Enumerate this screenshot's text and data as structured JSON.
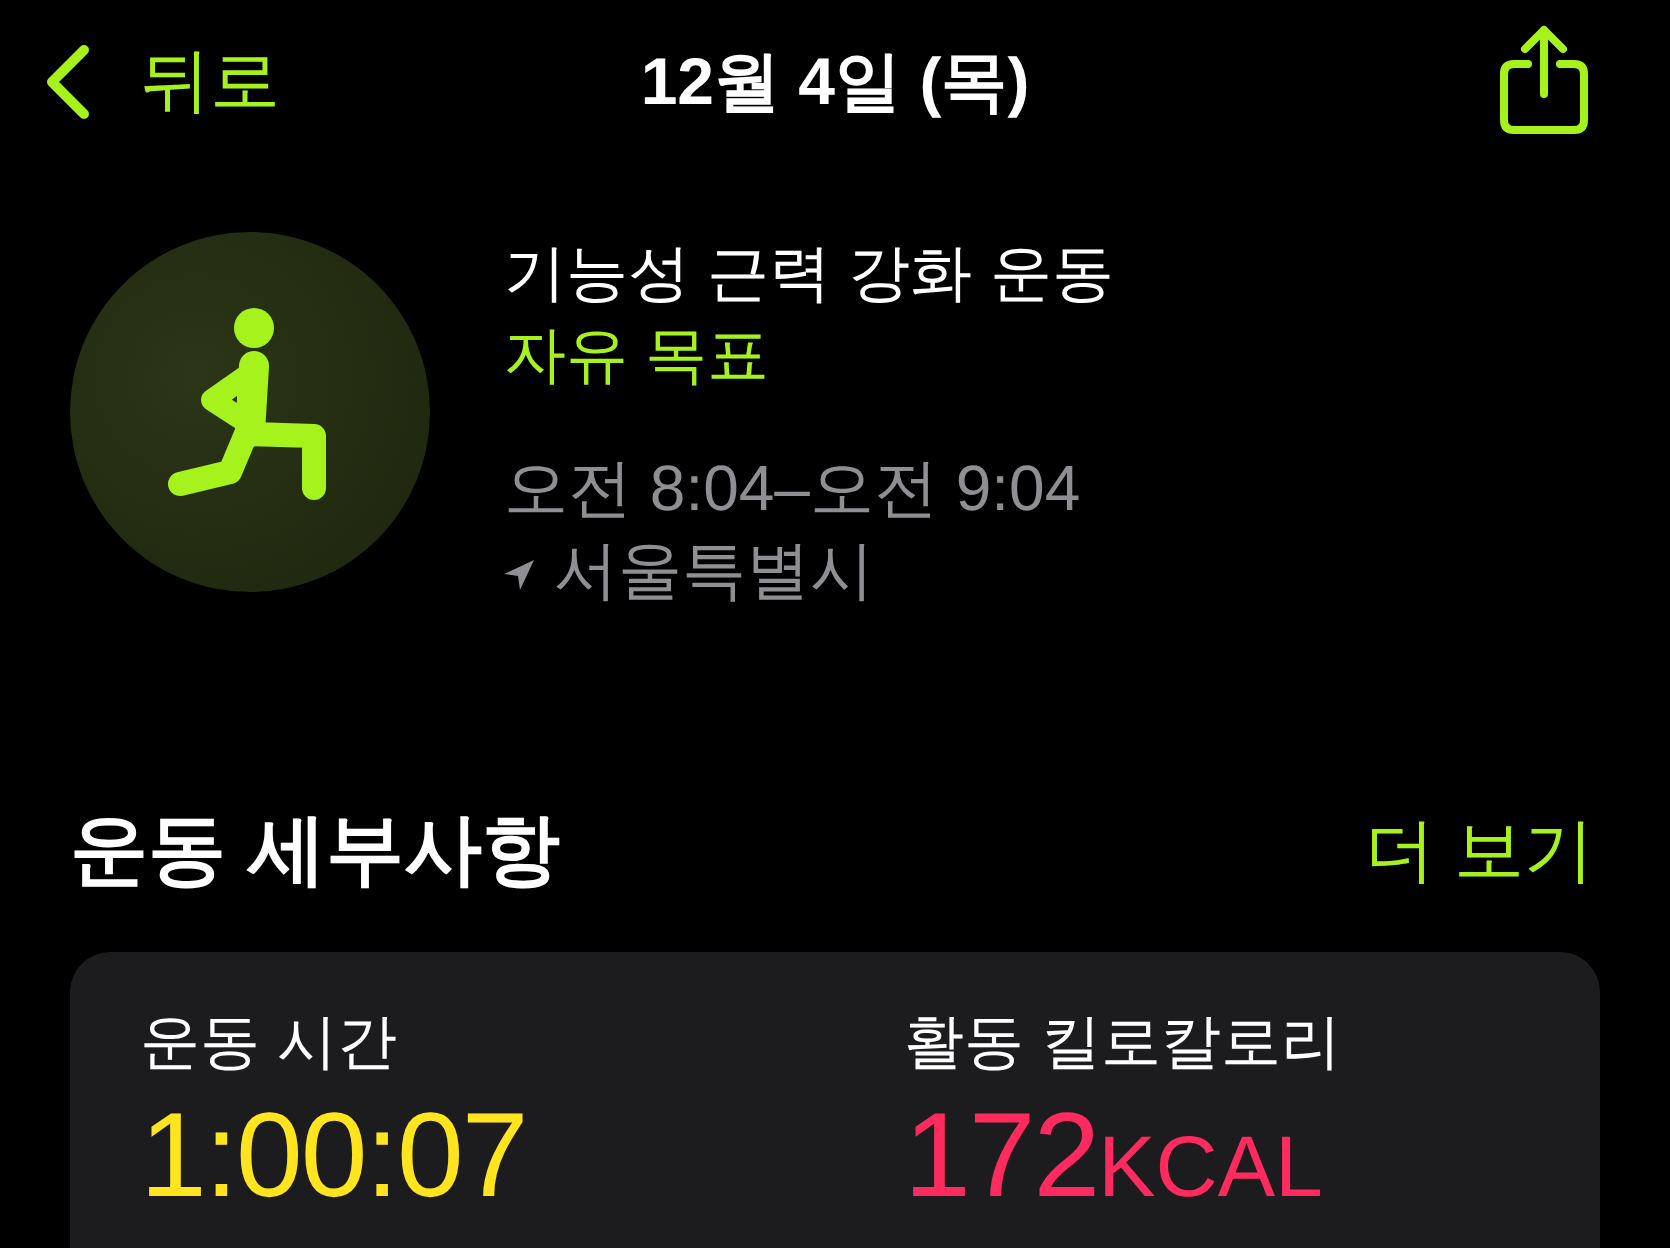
{
  "nav": {
    "back_label": "뒤로",
    "title": "12월 4일 (목)"
  },
  "workout": {
    "name": "기능성 근력 강화 운동",
    "goal": "자유 목표",
    "time_range": "오전 8:04–오전 9:04",
    "location": "서울특별시"
  },
  "details": {
    "title": "운동 세부사항",
    "more_link": "더 보기",
    "metrics": [
      {
        "label": "운동 시간",
        "value": "1:00:07",
        "color": "#ffe41e"
      },
      {
        "label": "활동 킬로칼로리",
        "value": "172",
        "unit": "KCAL",
        "color": "#ff2a5d"
      }
    ]
  }
}
